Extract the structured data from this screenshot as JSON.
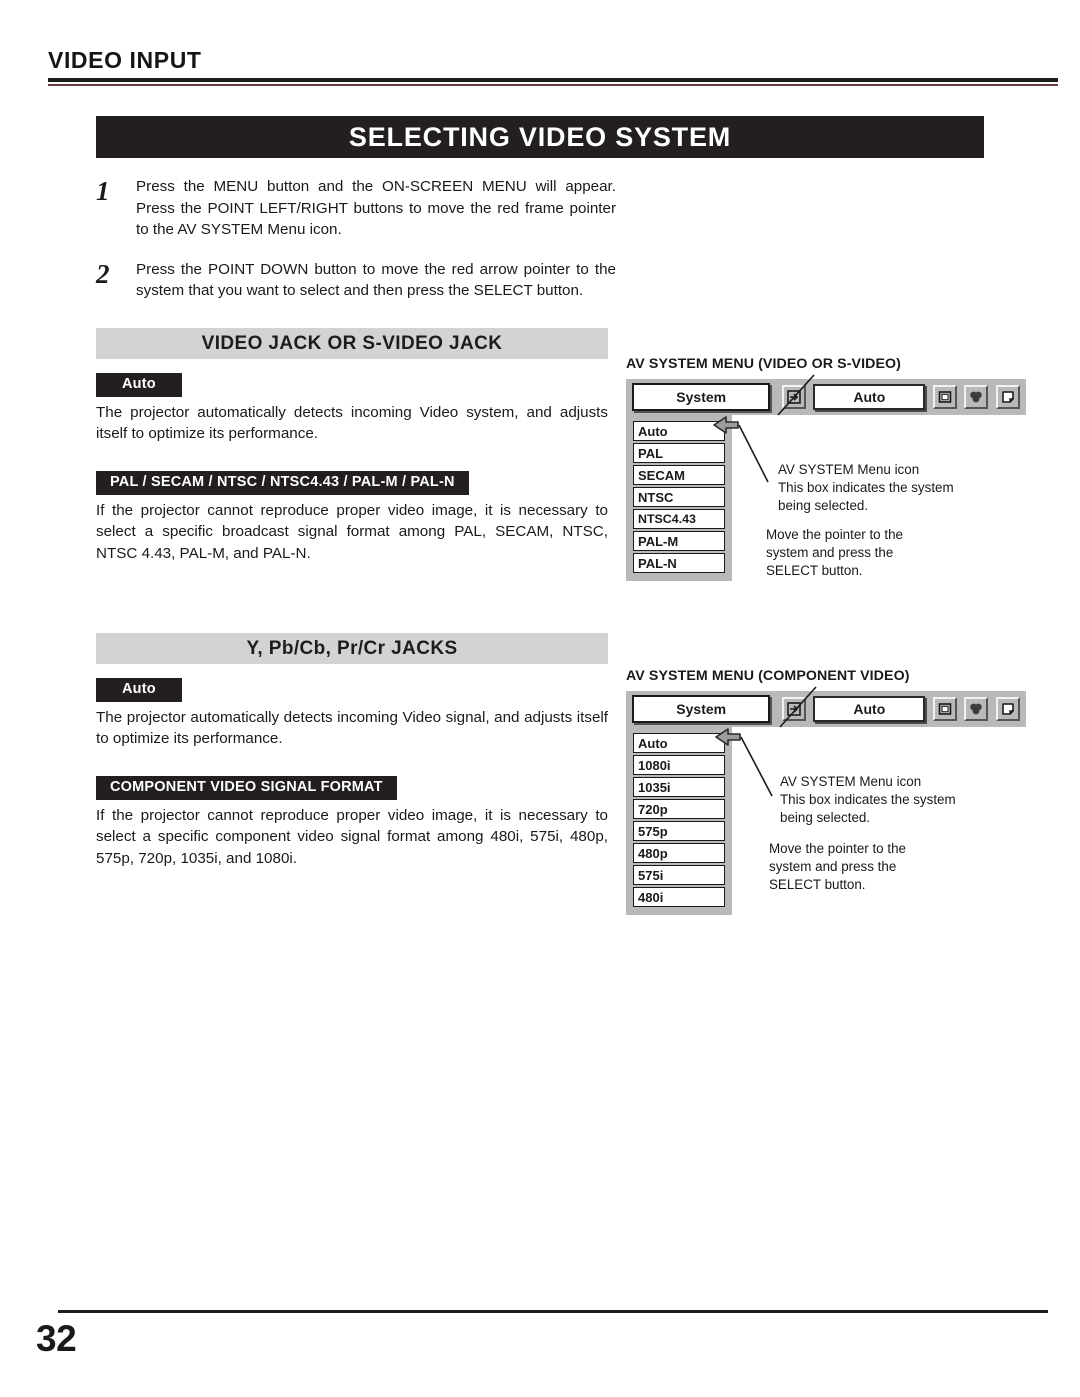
{
  "header": {
    "kicker": "VIDEO INPUT"
  },
  "banner": {
    "title": "SELECTING VIDEO SYSTEM"
  },
  "steps": [
    {
      "number": "1",
      "text": "Press the MENU button and the ON-SCREEN MENU will appear.  Press the POINT LEFT/RIGHT buttons to move the red frame pointer to the AV SYSTEM Menu icon."
    },
    {
      "number": "2",
      "text": "Press the POINT DOWN button to move the red arrow pointer to the system that you want to select and then press the SELECT button."
    }
  ],
  "sections": [
    {
      "heading": "VIDEO JACK OR S-VIDEO JACK",
      "auto_chip": "Auto",
      "auto_text": "The projector automatically detects incoming Video system, and adjusts itself to optimize its performance.",
      "format_chip": "PAL / SECAM / NTSC / NTSC4.43 / PAL-M / PAL-N",
      "format_text": "If the projector cannot reproduce proper video image, it is necessary to select a specific broadcast signal format among PAL, SECAM, NTSC, NTSC 4.43, PAL-M, and PAL-N."
    },
    {
      "heading": "Y, Pb/Cb, Pr/Cr JACKS",
      "auto_chip": "Auto",
      "auto_text": "The projector automatically detects incoming Video signal, and adjusts itself to optimize its performance.",
      "format_chip": "COMPONENT VIDEO SIGNAL FORMAT",
      "format_text": "If the projector cannot reproduce proper video image, it is necessary to select a specific component video signal format among 480i, 575i, 480p, 575p, 720p, 1035i, and 1080i."
    }
  ],
  "diagrams": [
    {
      "title": "AV SYSTEM MENU (VIDEO OR S-VIDEO)",
      "menu_label": "System",
      "selected_value": "Auto",
      "items": [
        "Auto",
        "PAL",
        "SECAM",
        "NTSC",
        "NTSC4.43",
        "PAL-M",
        "PAL-N"
      ],
      "callout_top": "AV SYSTEM Menu icon\nThis box indicates the system\nbeing selected.",
      "callout_bottom": "Move the pointer to the\nsystem and press the\nSELECT button."
    },
    {
      "title": "AV SYSTEM MENU (COMPONENT VIDEO)",
      "menu_label": "System",
      "selected_value": "Auto",
      "items": [
        "Auto",
        "1080i",
        "1035i",
        "720p",
        "575p",
        "480p",
        "575i",
        "480i"
      ],
      "callout_top": "AV SYSTEM Menu icon\nThis box indicates the system\nbeing selected.",
      "callout_bottom": "Move the pointer to the\nsystem and press the\nSELECT button."
    }
  ],
  "icons": {
    "input_icon": "input-source-icon",
    "screen_icon": "screen-icon",
    "color_icon": "color-adjust-icon",
    "page_icon": "page-curl-icon",
    "pointer_icon": "left-arrow-pointer-icon"
  },
  "footer": {
    "page_number": "32"
  },
  "colors": {
    "banner_bg": "#231f20",
    "section_head_bg": "#d2d3d5",
    "chip_bg": "#231f20",
    "osd_gray": "#b9b9b9",
    "rule_accent": "#6b3f42"
  }
}
